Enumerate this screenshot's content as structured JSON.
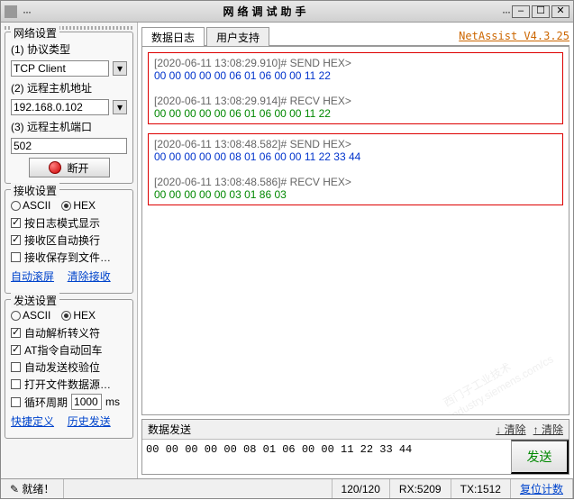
{
  "title": "网络调试助手",
  "window_buttons": {
    "min": "–",
    "max": "☐",
    "close": "✕"
  },
  "network": {
    "group_title": "网络设置",
    "proto_label": "(1) 协议类型",
    "proto_value": "TCP Client",
    "host_label": "(2) 远程主机地址",
    "host_value": "192.168.0.102",
    "port_label": "(3) 远程主机端口",
    "port_value": "502",
    "disconnect": "断开"
  },
  "recv": {
    "group_title": "接收设置",
    "ascii": "ASCII",
    "hex": "HEX",
    "c1": "按日志模式显示",
    "c2": "接收区自动换行",
    "c3": "接收保存到文件…",
    "link1": "自动滚屏",
    "link2": "清除接收"
  },
  "send": {
    "group_title": "发送设置",
    "ascii": "ASCII",
    "hex": "HEX",
    "c1": "自动解析转义符",
    "c2": "AT指令自动回车",
    "c3": "自动发送校验位",
    "c4": "打开文件数据源…",
    "cycle_label": "循环周期",
    "cycle_value": "1000",
    "cycle_unit": "ms",
    "link1": "快捷定义",
    "link2": "历史发送"
  },
  "tabs": {
    "t1": "数据日志",
    "t2": "用户支持"
  },
  "version": "NetAssist V4.3.25",
  "log": {
    "b1_ts1": "[2020-06-11 13:08:29.910]# SEND HEX>",
    "b1_d1": "00 00 00 00 00 06 01 06 00 00 11 22",
    "b1_ts2": "[2020-06-11 13:08:29.914]# RECV HEX>",
    "b1_d2": "00 00 00 00 00 06 01 06 00 00 11 22",
    "b2_ts1": "[2020-06-11 13:08:48.582]# SEND HEX>",
    "b2_d1": "00 00 00 00 00 08 01 06 00 00 11 22 33 44",
    "b2_ts2": "[2020-06-11 13:08:48.586]# RECV HEX>",
    "b2_d2": "00 00 00 00 00 03 01 86 03"
  },
  "watermark_line1": "西门子工业技术",
  "watermark_line2": "support.industry.siemens.com/cs",
  "send_panel": {
    "title": "数据发送",
    "clear_link": "清除",
    "send_btn": "发送",
    "input_value": "00 00 00 00 00 08 01 06 00 00 11 22 33 44"
  },
  "status": {
    "ready": "就绪！",
    "conn": "120/120",
    "rx": "RX:5209",
    "tx": "TX:1512",
    "reset": "复位计数"
  }
}
